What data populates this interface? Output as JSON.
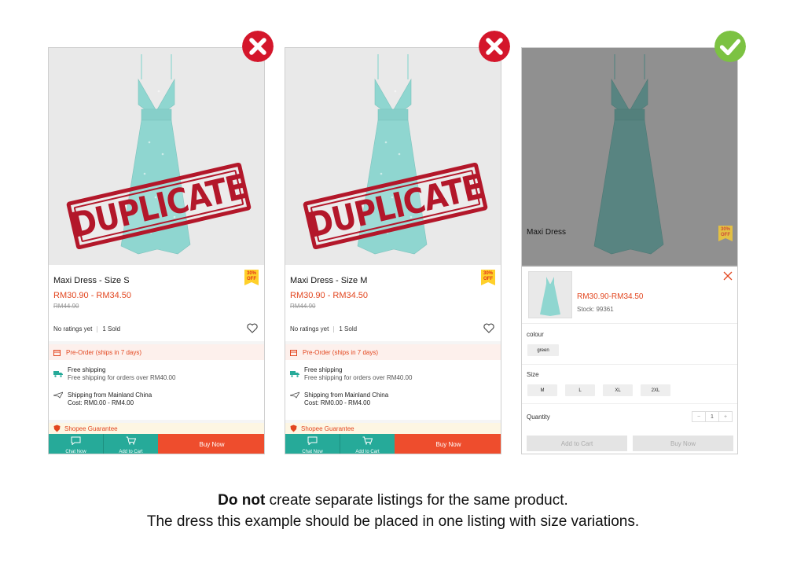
{
  "listings": [
    {
      "title": "Maxi Dress - Size S",
      "price": "RM30.90 - RM34.50",
      "old_price": "RM44.90",
      "stamp": "DUPLICATE",
      "badge": "30%\nOFF",
      "ratings": "No ratings yet",
      "sold": "1 Sold",
      "preorder": "Pre-Order (ships in 7 days)",
      "free_shipping": "Free shipping",
      "free_shipping_sub": "Free shipping for orders over RM40.00",
      "shipping_from": "Shipping from Mainland China",
      "shipping_cost": "Cost: RM0.00 - RM4.00",
      "guarantee": "Shopee Guarantee",
      "chat": "Chat Now",
      "add_to_cart": "Add to Cart",
      "buy_now": "Buy Now",
      "verdict": "wrong"
    },
    {
      "title": "Maxi Dress - Size M",
      "price": "RM30.90 - RM34.50",
      "old_price": "RM44.90",
      "stamp": "DUPLICATE",
      "badge": "30%\nOFF",
      "ratings": "No ratings yet",
      "sold": "1 Sold",
      "preorder": "Pre-Order (ships in 7 days)",
      "free_shipping": "Free shipping",
      "free_shipping_sub": "Free shipping for orders over RM40.00",
      "shipping_from": "Shipping from Mainland China",
      "shipping_cost": "Cost: RM0.00 - RM4.00",
      "guarantee": "Shopee Guarantee",
      "chat": "Chat Now",
      "add_to_cart": "Add to Cart",
      "buy_now": "Buy Now",
      "verdict": "wrong"
    }
  ],
  "variation_panel": {
    "title": "Maxi Dress",
    "badge": "30%\nOFF",
    "price": "RM30.90-RM34.50",
    "stock": "Stock: 99361",
    "colour_label": "colour",
    "colours": [
      "green"
    ],
    "size_label": "Size",
    "sizes": [
      "M",
      "L",
      "XL",
      "2XL"
    ],
    "quantity_label": "Quantity",
    "quantity": "1",
    "minus": "−",
    "plus": "+",
    "add_to_cart": "Add to Cart",
    "buy_now": "Buy Now",
    "verdict": "correct"
  },
  "caption": {
    "bold": "Do not",
    "line1_rest": " create separate listings for the same product.",
    "line2": "The dress this example should be placed in one listing with size variations."
  },
  "colors": {
    "shopee_orange": "#ee4d2d",
    "teal": "#26aa99",
    "wrong_red": "#d4162b",
    "correct_green": "#7cc242",
    "dress": "#8fd6d0",
    "stamp_red": "#b3172a"
  },
  "icons": [
    "cross-mark-icon",
    "check-mark-icon",
    "heart-icon",
    "chat-icon",
    "cart-icon",
    "truck-icon",
    "plane-icon",
    "shield-icon",
    "close-icon"
  ]
}
